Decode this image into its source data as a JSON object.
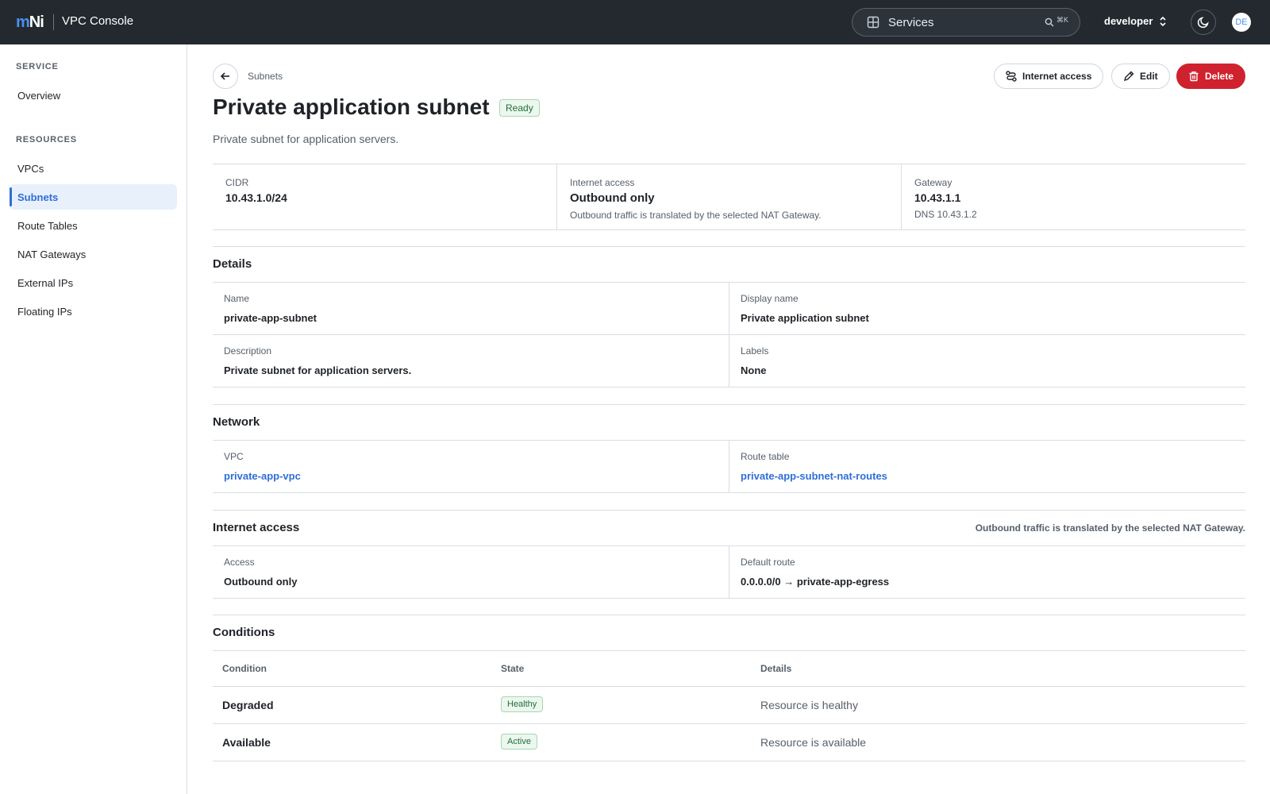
{
  "app": {
    "logo_m": "m",
    "logo_ni": "Ni",
    "title": "VPC Console"
  },
  "topbar": {
    "services_label": "Services",
    "shortcut": "⌘K",
    "user": "developer",
    "avatar_initials": "DE"
  },
  "sidebar": {
    "sections": [
      {
        "heading": "SERVICE",
        "items": [
          "Overview"
        ]
      },
      {
        "heading": "RESOURCES",
        "items": [
          "VPCs",
          "Subnets",
          "Route Tables",
          "NAT Gateways",
          "External IPs",
          "Floating IPs"
        ]
      }
    ],
    "active_item": "Subnets"
  },
  "header": {
    "breadcrumb": "Subnets",
    "title": "Private application subnet",
    "status": "Ready",
    "description": "Private subnet for application servers.",
    "actions": {
      "internet_access": "Internet access",
      "edit": "Edit",
      "delete": "Delete"
    }
  },
  "summary": {
    "cidr": {
      "label": "CIDR",
      "value": "10.43.1.0/24"
    },
    "internet": {
      "label": "Internet access",
      "value": "Outbound only",
      "note": "Outbound traffic is translated by the selected NAT Gateway."
    },
    "gateway": {
      "label": "Gateway",
      "value": "10.43.1.1",
      "note": "DNS 10.43.1.2"
    }
  },
  "details": {
    "title": "Details",
    "name": {
      "label": "Name",
      "value": "private-app-subnet"
    },
    "display_name": {
      "label": "Display name",
      "value": "Private application subnet"
    },
    "description": {
      "label": "Description",
      "value": "Private subnet for application servers."
    },
    "labels": {
      "label": "Labels",
      "value": "None"
    }
  },
  "network": {
    "title": "Network",
    "vpc": {
      "label": "VPC",
      "value": "private-app-vpc"
    },
    "route_table": {
      "label": "Route table",
      "value": "private-app-subnet-nat-routes"
    }
  },
  "internet_access": {
    "title": "Internet access",
    "note": "Outbound traffic is translated by the selected NAT Gateway.",
    "access": {
      "label": "Access",
      "value": "Outbound only"
    },
    "default_route": {
      "label": "Default route",
      "value": "0.0.0.0/0 → private-app-egress"
    }
  },
  "conditions": {
    "title": "Conditions",
    "columns": [
      "Condition",
      "State",
      "Details"
    ],
    "rows": [
      {
        "condition": "Degraded",
        "state": "Healthy",
        "details": "Resource is healthy"
      },
      {
        "condition": "Available",
        "state": "Active",
        "details": "Resource is available"
      }
    ]
  },
  "colors": {
    "accent": "#2f6fd6",
    "danger": "#cf222e",
    "topbar": "#24292f",
    "success_bg": "#ecf7ee"
  },
  "icons": [
    "grid-icon",
    "search-icon",
    "chevron-updown-icon",
    "moon-icon",
    "arrow-left-icon",
    "route-icon",
    "pencil-icon",
    "trash-icon"
  ]
}
